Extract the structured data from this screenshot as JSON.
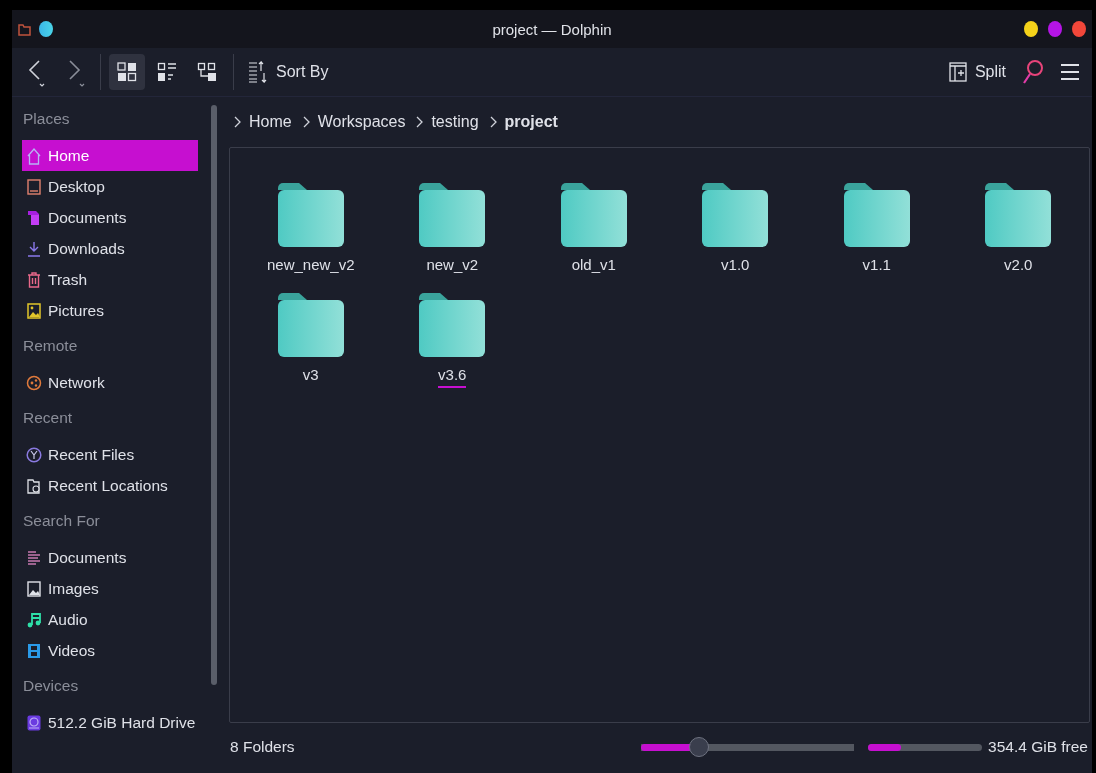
{
  "window": {
    "title": "project — Dolphin"
  },
  "toolbar": {
    "view_modes": [
      {
        "selected": true
      },
      {
        "selected": false
      },
      {
        "selected": false
      }
    ],
    "sort_label": "Sort By",
    "split_label": "Split"
  },
  "sidebar": {
    "sections": [
      {
        "title": "Places",
        "items": [
          {
            "label": "Home",
            "selected": true
          },
          {
            "label": "Desktop",
            "selected": false
          },
          {
            "label": "Documents",
            "selected": false
          },
          {
            "label": "Downloads",
            "selected": false
          },
          {
            "label": "Trash",
            "selected": false
          },
          {
            "label": "Pictures",
            "selected": false
          }
        ]
      },
      {
        "title": "Remote",
        "items": [
          {
            "label": "Network",
            "selected": false
          }
        ]
      },
      {
        "title": "Recent",
        "items": [
          {
            "label": "Recent Files",
            "selected": false
          },
          {
            "label": "Recent Locations",
            "selected": false
          }
        ]
      },
      {
        "title": "Search For",
        "items": [
          {
            "label": "Documents",
            "selected": false
          },
          {
            "label": "Images",
            "selected": false
          },
          {
            "label": "Audio",
            "selected": false
          },
          {
            "label": "Videos",
            "selected": false
          }
        ]
      },
      {
        "title": "Devices",
        "items": [
          {
            "label": "512.2 GiB Hard Drive",
            "selected": false
          }
        ]
      }
    ]
  },
  "breadcrumb": [
    {
      "label": "Home",
      "current": false
    },
    {
      "label": "Workspaces",
      "current": false
    },
    {
      "label": "testing",
      "current": false
    },
    {
      "label": "project",
      "current": true
    }
  ],
  "folders": [
    {
      "name": "new_new_v2",
      "focused": false
    },
    {
      "name": "new_v2",
      "focused": false
    },
    {
      "name": "old_v1",
      "focused": false
    },
    {
      "name": "v1.0",
      "focused": false
    },
    {
      "name": "v1.1",
      "focused": false
    },
    {
      "name": "v2.0",
      "focused": false
    },
    {
      "name": "v3",
      "focused": false
    },
    {
      "name": "v3.6",
      "focused": true
    }
  ],
  "status_bar": {
    "count": "8 Folders",
    "zoom": {
      "level": 0.27
    },
    "disk": {
      "level": 0.29,
      "reading": "354.4 GiB free"
    }
  }
}
